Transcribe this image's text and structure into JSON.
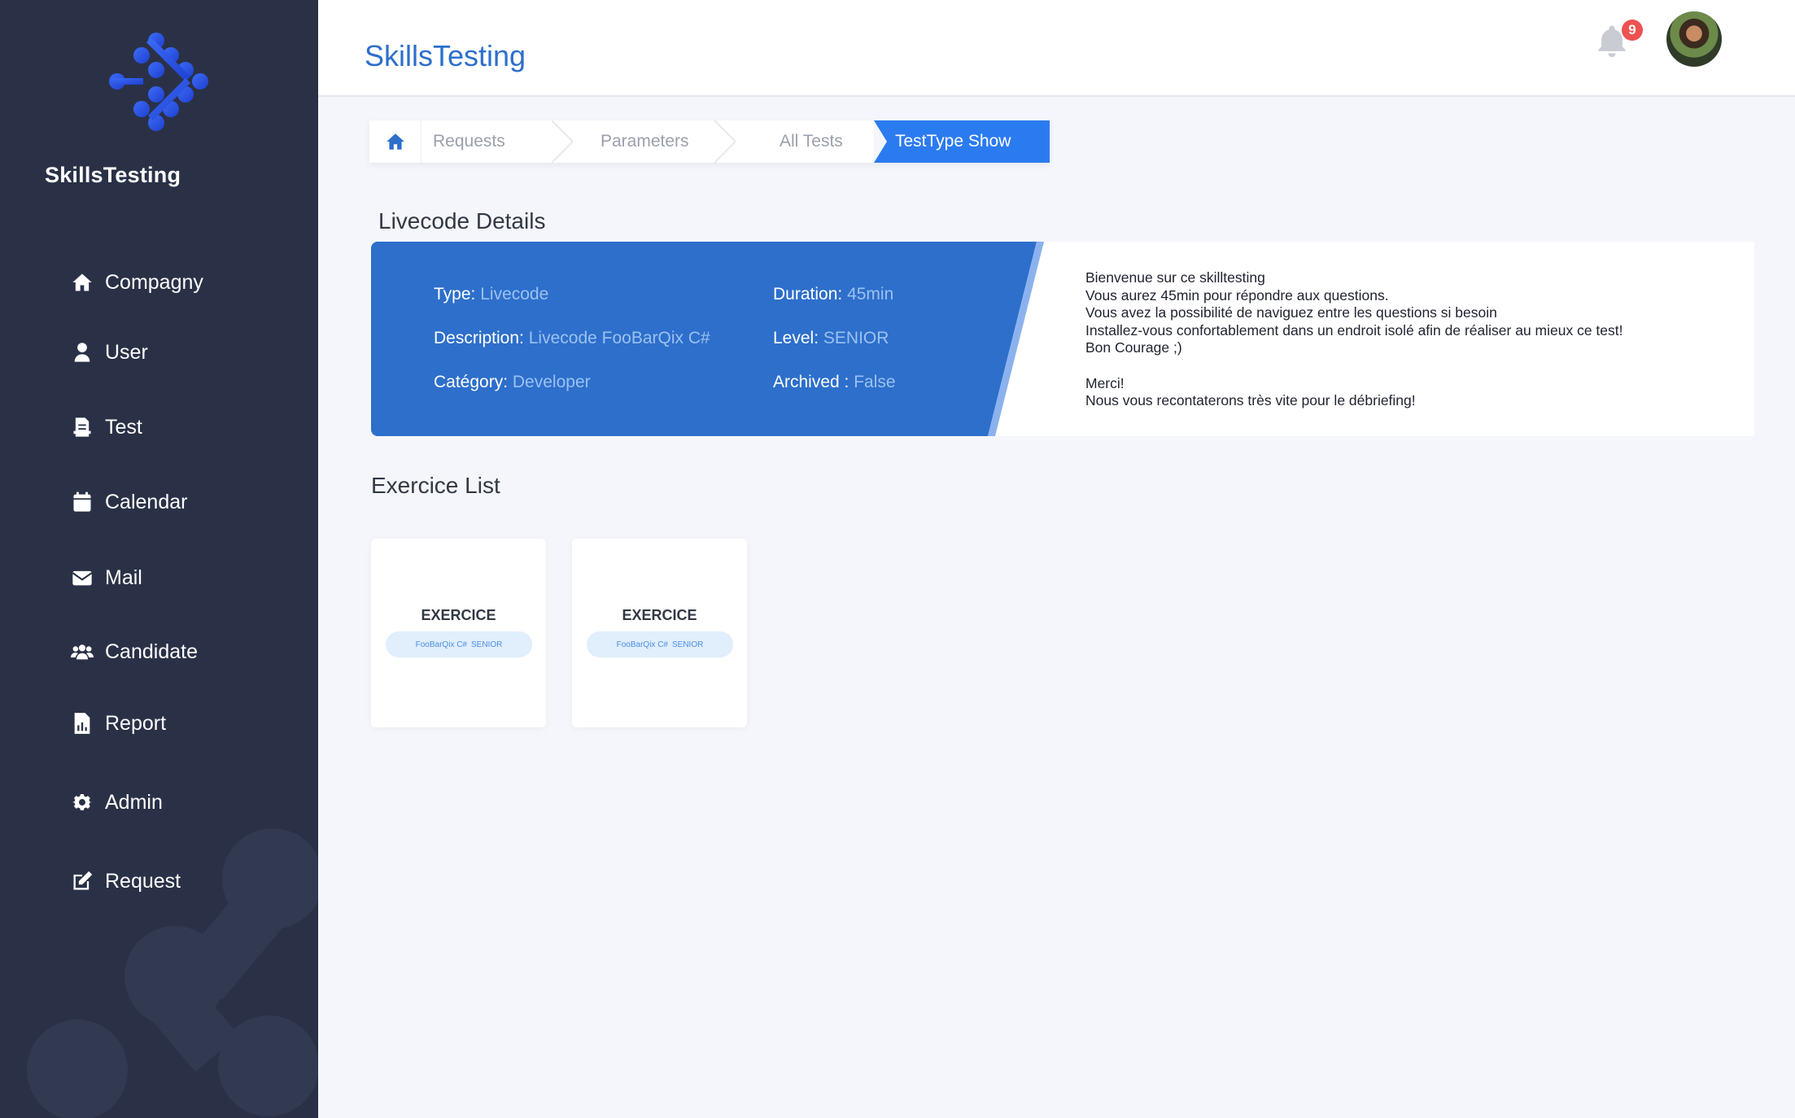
{
  "sidebar": {
    "brand": "SkillsTesting",
    "items": [
      {
        "label": "Compagny",
        "icon": "home-icon"
      },
      {
        "label": "User",
        "icon": "user-icon"
      },
      {
        "label": "Test",
        "icon": "test-icon"
      },
      {
        "label": "Calendar",
        "icon": "calendar-icon"
      },
      {
        "label": "Mail",
        "icon": "mail-icon"
      },
      {
        "label": "Candidate",
        "icon": "users-icon"
      },
      {
        "label": "Report",
        "icon": "report-icon"
      },
      {
        "label": "Admin",
        "icon": "gear-icon"
      },
      {
        "label": "Request",
        "icon": "edit-icon"
      }
    ]
  },
  "header": {
    "title": "SkillsTesting",
    "notification_count": "9"
  },
  "breadcrumb": {
    "items": [
      "Requests",
      "Parameters",
      "All Tests"
    ],
    "active": "TestType Show"
  },
  "details": {
    "title": "Livecode Details",
    "type_label": "Type:",
    "type_value": "Livecode",
    "description_label": "Description:",
    "description_value": "Livecode FooBarQix C#",
    "category_label": "Catégory:",
    "category_value": "Developer",
    "duration_label": "Duration:",
    "duration_value": "45min",
    "level_label": "Level:",
    "level_value": "SENIOR",
    "archived_label": "Archived :",
    "archived_value": "False",
    "welcome_lines": [
      "Bienvenue sur ce skilltesting",
      "Vous aurez 45min pour répondre aux questions.",
      "Vous avez la possibilité de naviguez entre les questions si besoin",
      "Installez-vous confortablement dans un endroit isolé afin de réaliser au mieux ce test!",
      "Bon Courage ;)",
      "",
      "Merci!",
      "Nous vous recontaterons très vite pour le débriefing!"
    ]
  },
  "exercises": {
    "title": "Exercice List",
    "cards": [
      {
        "title": "EXERCICE",
        "name": "FooBarQix C#",
        "level": "SENIOR"
      },
      {
        "title": "EXERCICE",
        "name": "FooBarQix C#",
        "level": "SENIOR"
      }
    ]
  },
  "colors": {
    "sidebar_bg": "#2a3147",
    "accent": "#2d6fcb",
    "active_crumb": "#2b7bf0",
    "badge": "#ee5252"
  }
}
